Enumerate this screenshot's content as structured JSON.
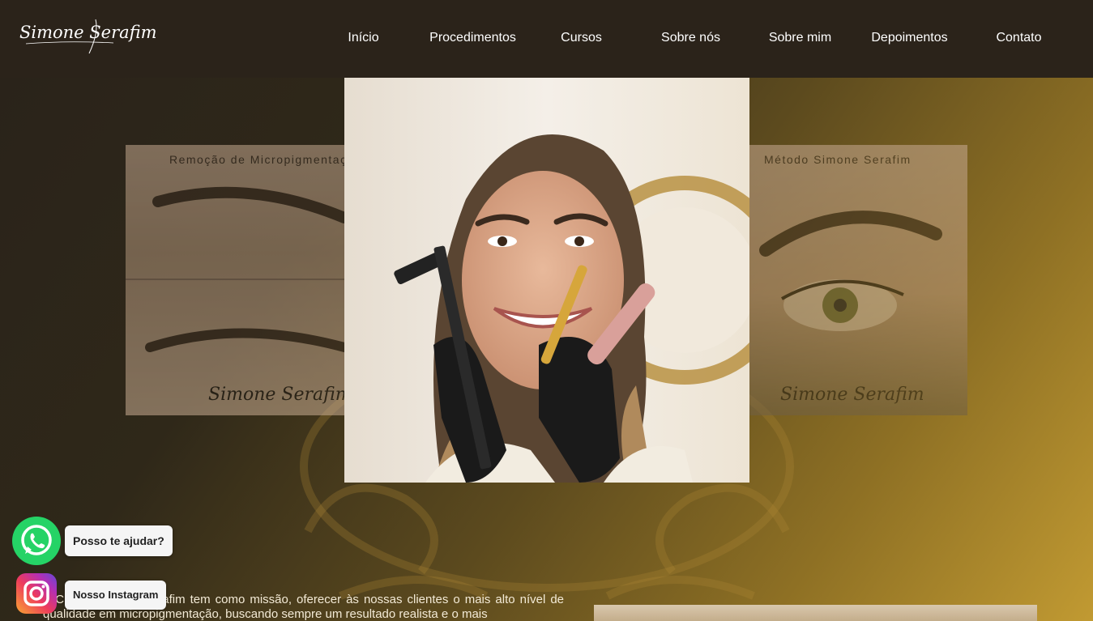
{
  "header": {
    "logo_text": "Simone Serafim",
    "nav": [
      "Início",
      "Procedimentos",
      "Cursos",
      "Sobre nós",
      "Sobre mim",
      "Depoimentos",
      "Contato"
    ]
  },
  "carousel": {
    "left_label": "Remoção de Micropigmentação",
    "right_label": "Método Simone Serafim",
    "signature": "Simone Serafim"
  },
  "about": {
    "text": "A Clínica Simone Serafim tem como missão, oferecer às nossas clientes o mais alto nível de qualidade em micropigmentação, buscando sempre um resultado realista e o mais"
  },
  "floating": {
    "whatsapp_label": "Posso te ajudar?",
    "instagram_label": "Nosso Instagram"
  },
  "colors": {
    "header_bg": "#2b231a",
    "gold_accent": "#c19a32",
    "whatsapp": "#25d366"
  }
}
